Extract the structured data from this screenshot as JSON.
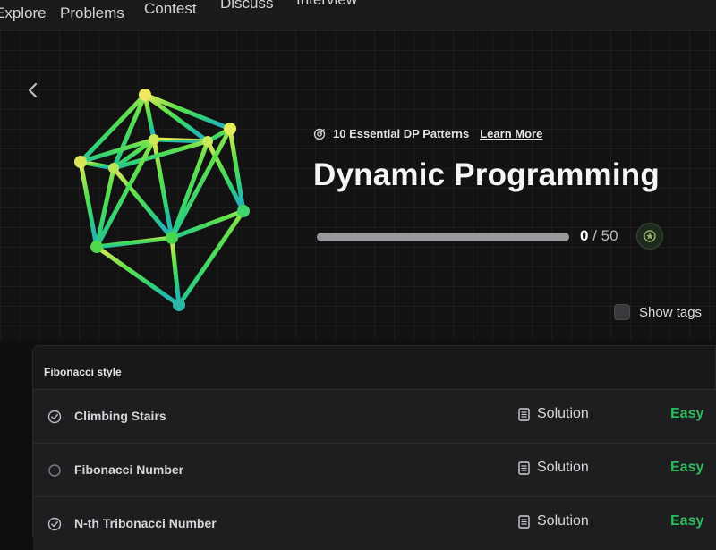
{
  "nav": {
    "items": [
      "Explore",
      "Problems",
      "Contest",
      "Discuss",
      "Interview"
    ]
  },
  "hero": {
    "pattern_label": "10 Essential DP Patterns",
    "learn_more": "Learn More",
    "title": "Dynamic Programming",
    "progress": {
      "done": "0",
      "separator": " / ",
      "total": "50",
      "fraction": 0.0
    },
    "show_tags_label": "Show tags",
    "show_tags_checked": false,
    "icons": {
      "back": "chevron-left-icon",
      "pattern": "target-icon",
      "badge": "badge-icon"
    }
  },
  "section": {
    "title": "Fibonacci style",
    "problems": [
      {
        "title": "Climbing Stairs",
        "status": "solved",
        "solution": "Solution",
        "difficulty": "Easy"
      },
      {
        "title": "Fibonacci Number",
        "status": "unsolved",
        "solution": "Solution",
        "difficulty": "Easy"
      },
      {
        "title": "N-th Tribonacci Number",
        "status": "solved",
        "solution": "Solution",
        "difficulty": "Easy"
      }
    ]
  },
  "colors": {
    "accent_green": "#2cbb5d",
    "easy": "#2cbb5d",
    "background": "#0f0f10"
  }
}
